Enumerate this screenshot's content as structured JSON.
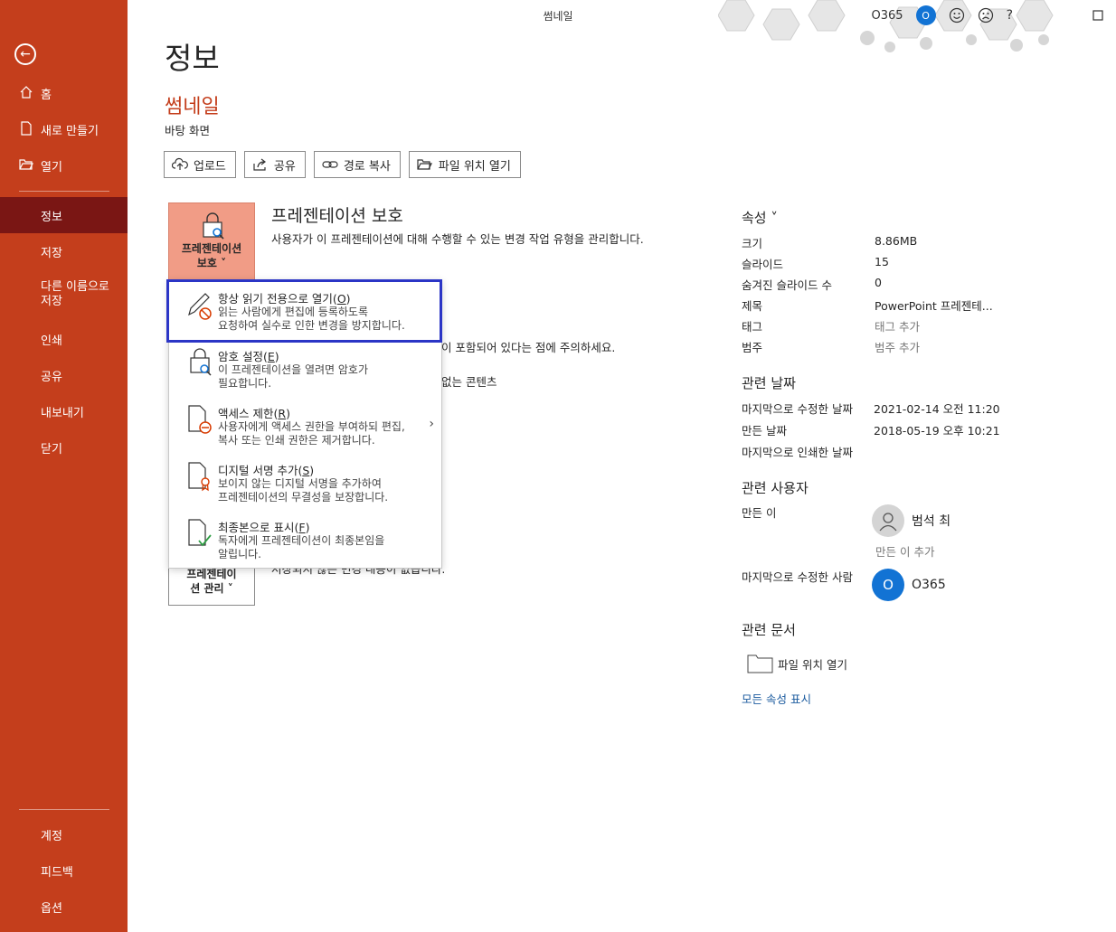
{
  "window": {
    "title": "썸네일",
    "account_name": "O365",
    "account_initial": "O",
    "help_label": "?",
    "accent_color": "#c43e1c"
  },
  "sidebar": {
    "back_icon": "back-arrow-icon",
    "items": [
      {
        "label": "홈",
        "icon": "home-icon"
      },
      {
        "label": "새로 만들기",
        "icon": "new-doc-icon"
      },
      {
        "label": "열기",
        "icon": "open-folder-icon"
      },
      {
        "label": "정보",
        "selected": true
      },
      {
        "label": "저장"
      },
      {
        "label": "다른 이름으로 저장"
      },
      {
        "label": "인쇄"
      },
      {
        "label": "공유"
      },
      {
        "label": "내보내기"
      },
      {
        "label": "닫기"
      },
      {
        "label": "계정"
      },
      {
        "label": "피드백"
      },
      {
        "label": "옵션"
      }
    ]
  },
  "main": {
    "page_title": "정보",
    "doc_name": "썸네일",
    "doc_location": "바탕 화면",
    "buttons": [
      {
        "label": "업로드",
        "icon": "upload-icon"
      },
      {
        "label": "공유",
        "icon": "share-icon"
      },
      {
        "label": "경로 복사",
        "icon": "link-icon"
      },
      {
        "label": "파일 위치 열기",
        "icon": "folder-open-icon"
      }
    ],
    "protect": {
      "tile_label_1": "프레젠테이션",
      "tile_label_2": "보호 ˅",
      "title": "프레젠테이션 보호",
      "desc": "사용자가 이 프레젠테이션에 대해 수행할 수 있는 변경 작업 유형을 관리합니다."
    },
    "partial_text_1": "이 포함되어 있다는 점에 주의하세요.",
    "partial_text_2": "없는 콘텐츠",
    "partial_text_3": "저장되지 않은 변경 내용이 없습니다.",
    "manage": {
      "tile_label_1": "프레젠테이",
      "tile_label_2": "션 관리 ˅"
    }
  },
  "dropdown": {
    "items": [
      {
        "title": "항상 읽기 전용으로 열기",
        "key": "O",
        "desc_1": "읽는 사람에게 편집에 등록하도록",
        "desc_2": "요청하여 실수로 인한 변경을 방지합니다.",
        "icon": "pencil-no-icon"
      },
      {
        "title": "암호 설정",
        "key": "E",
        "desc_1": "이 프레젠테이션을 열려면 암호가",
        "desc_2": "필요합니다.",
        "icon": "lock-key-icon"
      },
      {
        "title": "액세스 제한",
        "key": "R",
        "desc_1": "사용자에게 액세스 권한을 부여하되 편집,",
        "desc_2": "복사 또는 인쇄 권한은 제거합니다.",
        "icon": "doc-restrict-icon"
      },
      {
        "title": "디지털 서명 추가",
        "key": "S",
        "desc_1": "보이지 않는 디지털 서명을 추가하여",
        "desc_2": "프레젠테이션의 무결성을 보장합니다.",
        "icon": "doc-ribbon-icon"
      },
      {
        "title": "최종본으로 표시",
        "key": "F",
        "desc_1": "독자에게 프레젠테이션이 최종본임을",
        "desc_2": "알립니다.",
        "icon": "doc-check-icon"
      }
    ],
    "highlight_color": "#2b35c6"
  },
  "properties": {
    "header": "속성 ˅",
    "rows": [
      {
        "label": "크기",
        "value": "8.86MB"
      },
      {
        "label": "슬라이드",
        "value": "15"
      },
      {
        "label": "숨겨진 슬라이드 수",
        "value": "0"
      },
      {
        "label": "제목",
        "value": "PowerPoint 프레젠테..."
      },
      {
        "label": "태그",
        "value": "태그 추가"
      },
      {
        "label": "범주",
        "value": "범주 추가"
      }
    ],
    "dates_header": "관련 날짜",
    "dates": [
      {
        "label": "마지막으로 수정한 날짜",
        "value": "2021-02-14 오전 11:20"
      },
      {
        "label": "만든 날짜",
        "value": "2018-05-19 오후 10:21"
      },
      {
        "label": "마지막으로 인쇄한 날짜",
        "value": ""
      }
    ],
    "people_header": "관련 사용자",
    "author_label": "만든 이",
    "author_name": "범석 최",
    "add_author": "만든 이 추가",
    "last_modified_by_label": "마지막으로 수정한 사람",
    "last_modified_by": "O365",
    "last_modified_initial": "O",
    "docs_header": "관련 문서",
    "open_location": "파일 위치 열기",
    "show_all": "모든 속성 표시"
  }
}
